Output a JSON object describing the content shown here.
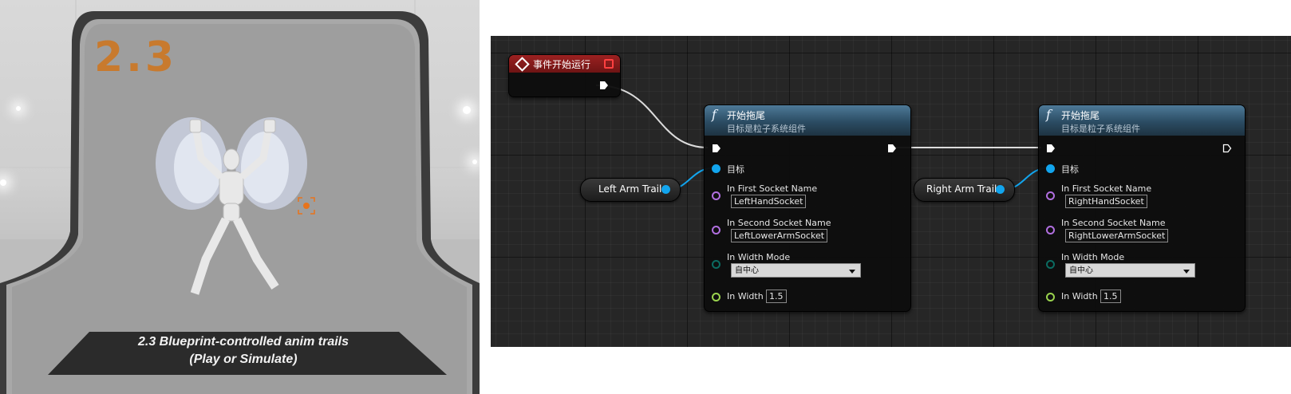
{
  "viewport": {
    "number": "2.3",
    "title_line1": "2.3  Blueprint-controlled anim trails",
    "title_line2": "(Play or Simulate)"
  },
  "graph": {
    "event_node": {
      "title": "事件开始运行",
      "icon": "event-diamond-icon"
    },
    "function_nodes": [
      {
        "title": "开始拖尾",
        "subtitle": "目标是粒子系统组件",
        "target_label": "目标",
        "first_socket_label": "In First Socket Name",
        "first_socket_value": "LeftHandSocket",
        "second_socket_label": "In Second Socket Name",
        "second_socket_value": "LeftLowerArmSocket",
        "width_mode_label": "In Width Mode",
        "width_mode_value": "自中心",
        "width_label": "In Width",
        "width_value": "1.5"
      },
      {
        "title": "开始拖尾",
        "subtitle": "目标是粒子系统组件",
        "target_label": "目标",
        "first_socket_label": "In First Socket Name",
        "first_socket_value": "RightHandSocket",
        "second_socket_label": "In Second Socket Name",
        "second_socket_value": "RightLowerArmSocket",
        "width_mode_label": "In Width Mode",
        "width_mode_value": "自中心",
        "width_label": "In Width",
        "width_value": "1.5"
      }
    ],
    "variables": [
      {
        "label": "Left Arm Trail"
      },
      {
        "label": "Right Arm Trail"
      }
    ],
    "function_icon": "f",
    "colors": {
      "event_header": "#9c2121",
      "function_header": "#4e7a98",
      "object_pin": "#12a5ee",
      "name_pin": "#b16fe0",
      "enum_pin": "#0b6b61",
      "float_pin": "#9ad34e",
      "background": "#262626"
    }
  }
}
